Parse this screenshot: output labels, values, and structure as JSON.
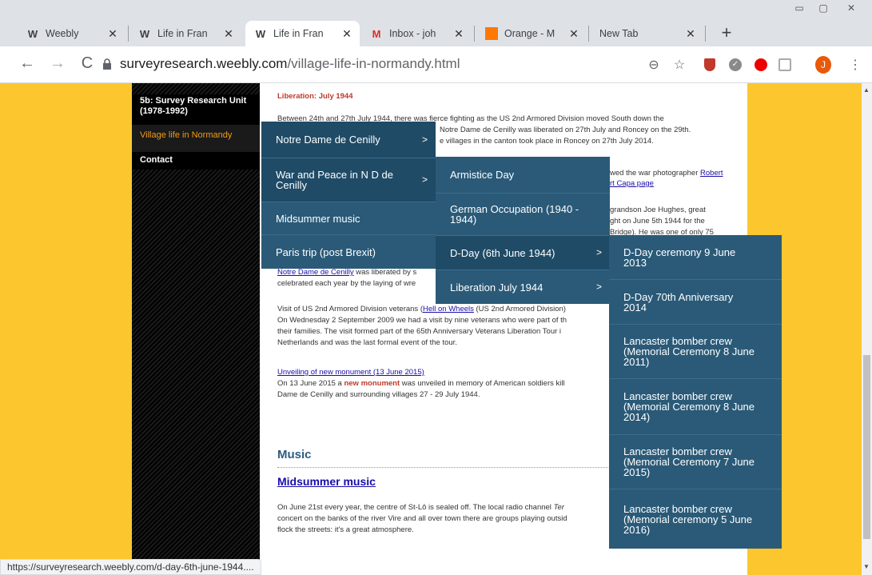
{
  "browser": {
    "tabs": [
      {
        "title": "Weebly",
        "icon": "weebly-icon"
      },
      {
        "title": "Life in Fran",
        "icon": "weebly-icon"
      },
      {
        "title": "Life in Fran",
        "icon": "weebly-icon",
        "active": true
      },
      {
        "title": "Inbox - joh",
        "icon": "gmail-icon"
      },
      {
        "title": "Orange - M",
        "icon": "orange-icon"
      },
      {
        "title": "New Tab",
        "icon": ""
      }
    ],
    "url_host": "surveyresearch.weebly.com",
    "url_path": "/village-life-in-normandy.html",
    "profile_initial": "J",
    "status_url": "https://surveyresearch.weebly.com/d-day-6th-june-1944...."
  },
  "sidebar": {
    "items": [
      {
        "label": "5b: Survey Research Unit (1978-1992)"
      },
      {
        "label": "Village life in Normandy",
        "active": true
      },
      {
        "label": "Contact"
      }
    ]
  },
  "content": {
    "heading": "Liberation: July 1944",
    "para1": "Between 24th and 27th July 1944, there was fierce fighting as the US 2nd Armored Division moved South down the",
    "para1b": "Notre Dame de Cenilly was liberated on 27th July and Roncey on the 29th.",
    "para1c": "e villages in the canton took place in Roncey on 27th July 2014.",
    "para2a": "wed the war photographer",
    "para2link": "Robert",
    "para2b": "rt Capa page",
    "para3a": "grandson Joe Hughes, great",
    "para3b": "ght on June 5th 1944 for the",
    "para3c": "Bridge). He was one of only 75",
    "ndc_link": "Notre Dame de Cenilly",
    "ndc_text": "was liberated by s",
    "ndc_text2": "celebrated each year by the laying of wre",
    "visit_a": "Visit of US 2nd Armored Division veterans (",
    "visit_link": "Hell on Wheels",
    "visit_b": "(US 2nd Armored Division)",
    "visit2": "On Wednesday 2 September 2009 we had a visit by nine veterans who were part of th",
    "visit3": "their families.  The visit formed part of the 65th Anniversary Veterans Liberation Tour i",
    "visit4": "Netherlands and was the last formal event of the tour.",
    "unveil_link": "Unveiling of new monument (13 June 2015)",
    "unveil_a": "On 13 June 2015 a",
    "unveil_red": "new monument",
    "unveil_b": "was unveiled in memory of American soldiers kill",
    "unveil_c": "Dame de Cenilly and surrounding villages 27 - 29 July 1944.",
    "music_heading": "Music",
    "midsummer_heading": "Midsummer music",
    "music1": "On June 21st every year, the centre of St-Lô is sealed off.  The local radio channel",
    "music1i": "Ter",
    "music2": "concert on the banks of the river Vire and all over town there are groups playing outsid",
    "music3": "flock the streets: it's a great atmosphere."
  },
  "menus": {
    "level1": [
      {
        "label": "Notre Dame de Cenilly",
        "arrow": ">"
      },
      {
        "label": "War and Peace in N D de Cenilly",
        "arrow": ">"
      },
      {
        "label": "Midsummer music"
      },
      {
        "label": "Paris trip (post Brexit)"
      }
    ],
    "level2": [
      {
        "label": "Armistice Day"
      },
      {
        "label": "German Occupation (1940 - 1944)"
      },
      {
        "label": "D-Day (6th June 1944)",
        "arrow": ">"
      },
      {
        "label": "Liberation July 1944",
        "arrow": ">"
      }
    ],
    "level3": [
      {
        "label": "D-Day ceremony 9 June 2013"
      },
      {
        "label": "D-Day 70th Anniversary 2014"
      },
      {
        "label": "Lancaster bomber crew (Memorial Ceremony 8 June 2011)"
      },
      {
        "label": "Lancaster bomber crew (Memorial Ceremony 8 June 2014)"
      },
      {
        "label": "Lancaster bomber crew (Memorial Ceremony 7 June 2015)"
      },
      {
        "label": "Lancaster bomber crew (Memorial ceremony 5 June 2016)"
      }
    ]
  },
  "colors": {
    "page_bg": "#fcc72e",
    "menu_bg": "#2a5a78",
    "accent_red": "#c0392b",
    "active_link": "#f39c12"
  }
}
